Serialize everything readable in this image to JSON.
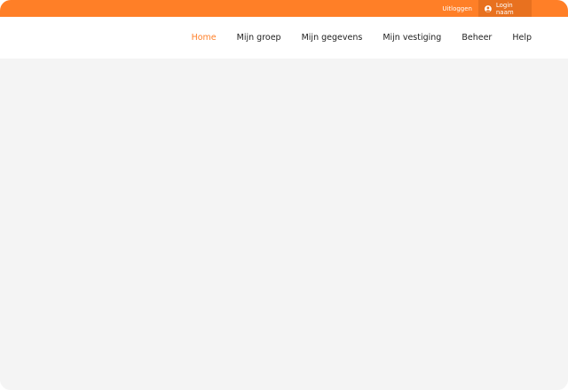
{
  "topbar": {
    "logout_label": "Uitloggen",
    "login_label": "Login naam",
    "user_icon": "user-circle-icon"
  },
  "nav": {
    "items": [
      {
        "label": "Home",
        "active": true
      },
      {
        "label": "Mijn groep"
      },
      {
        "label": "Mijn gegevens"
      },
      {
        "label": "Mijn vestiging"
      },
      {
        "label": "Beheer"
      },
      {
        "label": "Help"
      }
    ]
  },
  "colors": {
    "accent": "#ff7f27",
    "accent_dark": "#e8711f",
    "background": "#f4f4f4"
  }
}
